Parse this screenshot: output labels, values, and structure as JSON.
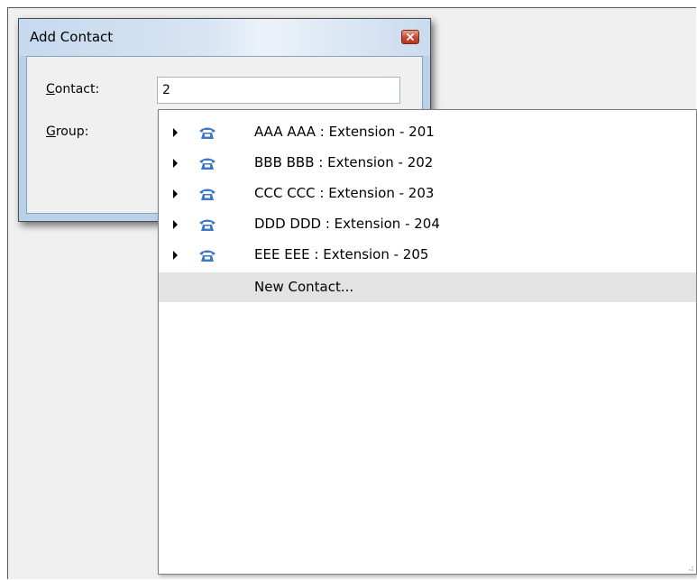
{
  "dialog": {
    "title": "Add Contact",
    "contact_label": {
      "accel": "C",
      "rest": "ontact:"
    },
    "group_label": {
      "accel": "G",
      "rest": "roup:"
    },
    "contact_value": "2"
  },
  "dropdown": {
    "items": [
      {
        "label": "AAA AAA : Extension - 201",
        "icon": "phone-icon",
        "expandable": true
      },
      {
        "label": "BBB BBB : Extension - 202",
        "icon": "phone-icon",
        "expandable": true
      },
      {
        "label": "CCC CCC : Extension - 203",
        "icon": "phone-icon",
        "expandable": true
      },
      {
        "label": "DDD DDD : Extension - 204",
        "icon": "phone-icon",
        "expandable": true
      },
      {
        "label": "EEE EEE : Extension - 205",
        "icon": "phone-icon",
        "expandable": true
      }
    ],
    "new_contact": "New Contact..."
  },
  "colors": {
    "phone_icon": "#3f76c8",
    "hover_row": "#e3e3e3",
    "dialog_frame": "#b9d1ea",
    "close_button": "#c7462b"
  }
}
